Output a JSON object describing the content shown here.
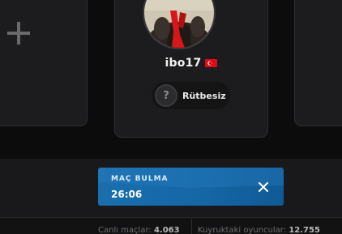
{
  "lobby": {
    "player": {
      "name": "ibo17",
      "country_flag": "turkey-flag-icon",
      "rank_label": "Rütbesiz",
      "rank_icon_glyph": "?"
    },
    "empty_slot_icon": "plus-icon"
  },
  "matchmaking": {
    "title": "MAÇ BULMA",
    "timer": "26:06",
    "close_icon": "close-icon",
    "color": "#1567a6"
  },
  "footer": {
    "live_matches_label": "Canlı maçlar:",
    "live_matches_value": "4.063",
    "queue_players_label": "Kuyruktaki oyuncular:",
    "queue_players_value": "12.755"
  },
  "colors": {
    "accent_blue": "#1567a6",
    "flag_red": "#e30a17"
  }
}
